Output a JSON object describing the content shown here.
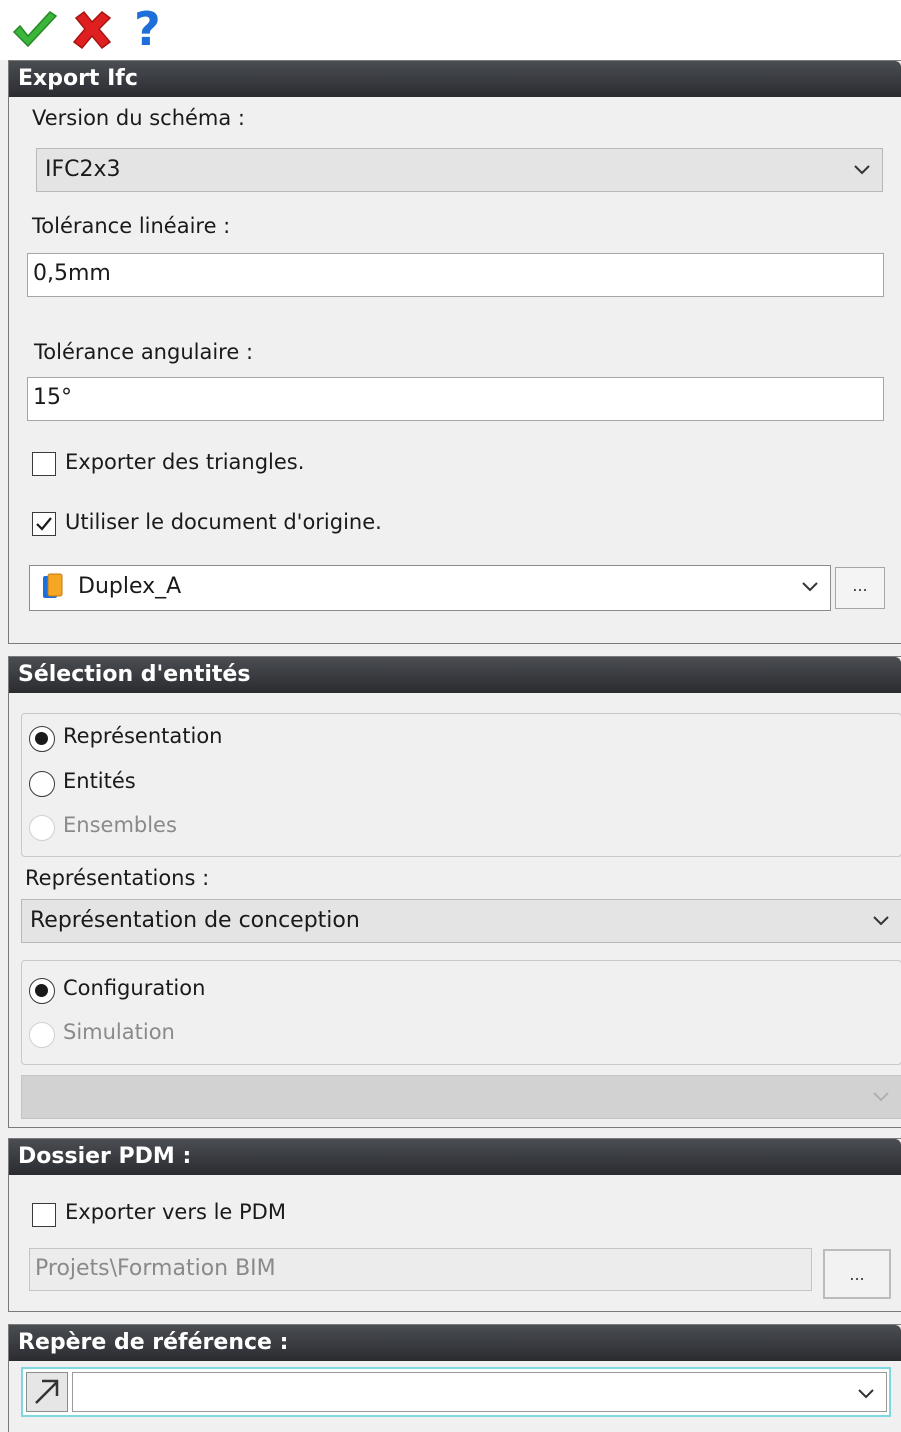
{
  "toolbar": {
    "ok_icon": "green-check-icon",
    "cancel_icon": "red-x-icon",
    "help_icon": "help-question-icon",
    "help_glyph": "?"
  },
  "export_ifc": {
    "title": "Export Ifc",
    "schema_label": "Version du schéma :",
    "schema_value": "IFC2x3",
    "linear_tol_label": "Tolérance linéaire :",
    "linear_tol_value": "0,5mm",
    "angular_tol_label": "Tolérance angulaire :",
    "angular_tol_value": "15°",
    "export_triangles_label": "Exporter des triangles.",
    "export_triangles_checked": false,
    "use_origin_doc_label": "Utiliser le document d'origine.",
    "use_origin_doc_checked": true,
    "document_value": "Duplex_A",
    "browse_label": "..."
  },
  "entity_selection": {
    "title": "Sélection d'entités",
    "options": [
      {
        "label": "Représentation",
        "selected": true,
        "enabled": true
      },
      {
        "label": "Entités",
        "selected": false,
        "enabled": true
      },
      {
        "label": "Ensembles",
        "selected": false,
        "enabled": false
      }
    ],
    "representations_label": "Représentations :",
    "representations_value": "Représentation de conception",
    "mode_options": [
      {
        "label": "Configuration",
        "selected": true,
        "enabled": true
      },
      {
        "label": "Simulation",
        "selected": false,
        "enabled": false
      }
    ],
    "config_value": ""
  },
  "pdm": {
    "title": "Dossier PDM :",
    "export_pdm_label": "Exporter vers le PDM",
    "export_pdm_checked": false,
    "path_value": "Projets\\Formation BIM",
    "browse_label": "..."
  },
  "reference": {
    "title": "Repère de référence :",
    "value": ""
  },
  "colors": {
    "header_bg": "#2e3034",
    "ok_green": "#3bb53b",
    "cancel_red": "#e02020",
    "help_blue": "#1e6fd9",
    "focus_cyan": "#7fd8e0"
  }
}
